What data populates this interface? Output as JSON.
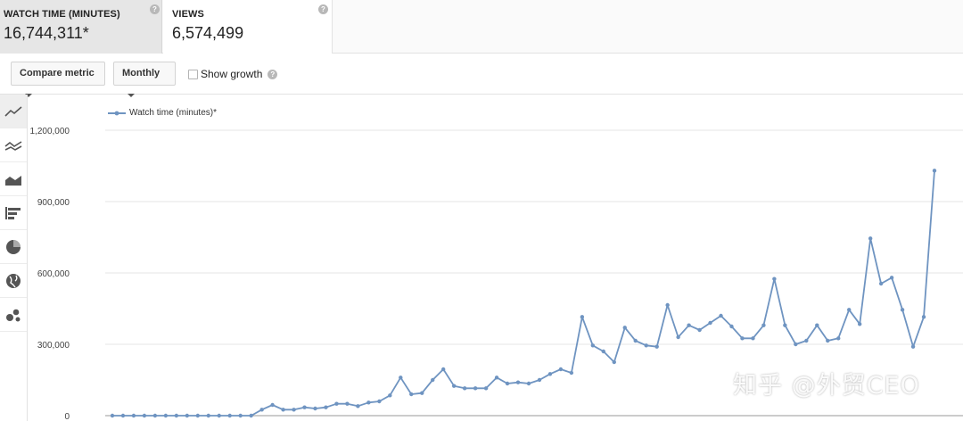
{
  "metrics": [
    {
      "label": "WATCH TIME (MINUTES)",
      "value": "16,744,311*",
      "help": "?"
    },
    {
      "label": "VIEWS",
      "value": "6,574,499",
      "help": "?"
    }
  ],
  "toolbar": {
    "compare_label": "Compare metric",
    "period_label": "Monthly",
    "show_growth_label": "Show growth",
    "help": "?"
  },
  "sidebar": {
    "items": [
      {
        "icon": "line-chart-icon"
      },
      {
        "icon": "multiline-chart-icon"
      },
      {
        "icon": "area-chart-icon"
      },
      {
        "icon": "bar-chart-icon"
      },
      {
        "icon": "pie-chart-icon"
      },
      {
        "icon": "globe-icon"
      },
      {
        "icon": "bubble-chart-icon"
      }
    ]
  },
  "watermark": "知乎 @外贸CEO",
  "colors": {
    "series": "#6f94c1",
    "grid": "#e6e6e6",
    "active_card": "#e6e6e6"
  },
  "chart_data": {
    "type": "line",
    "title": "",
    "ylim": [
      0,
      1200000
    ],
    "yticks": [
      0,
      300000,
      600000,
      900000,
      1200000
    ],
    "ytick_labels": [
      "0",
      "300,000",
      "600,000",
      "900,000",
      "1,200,000"
    ],
    "grid": true,
    "legend_position": "top-left",
    "series": [
      {
        "name": "Watch time (minutes)*",
        "values": [
          0,
          0,
          0,
          0,
          0,
          0,
          0,
          0,
          0,
          0,
          0,
          0,
          0,
          0,
          25000,
          45000,
          25000,
          25000,
          35000,
          30000,
          35000,
          50000,
          50000,
          40000,
          55000,
          60000,
          85000,
          160000,
          90000,
          95000,
          150000,
          195000,
          125000,
          115000,
          115000,
          115000,
          160000,
          135000,
          140000,
          135000,
          150000,
          175000,
          195000,
          180000,
          415000,
          295000,
          270000,
          225000,
          370000,
          315000,
          295000,
          290000,
          465000,
          330000,
          380000,
          360000,
          390000,
          420000,
          375000,
          325000,
          325000,
          380000,
          575000,
          380000,
          300000,
          315000,
          380000,
          315000,
          325000,
          445000,
          385000,
          745000,
          555000,
          580000,
          445000,
          290000,
          415000,
          1030000
        ]
      }
    ]
  }
}
